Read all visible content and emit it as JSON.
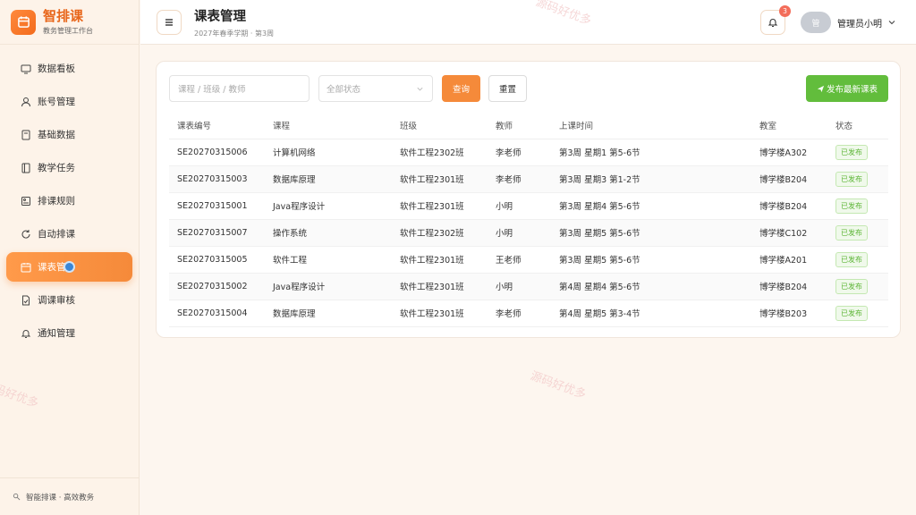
{
  "brand": {
    "title": "智排课",
    "subtitle": "教务管理工作台"
  },
  "sidebar": {
    "items": [
      {
        "label": "数据看板",
        "icon": "dashboard-icon",
        "active": false
      },
      {
        "label": "账号管理",
        "icon": "user-icon",
        "active": false
      },
      {
        "label": "基础数据",
        "icon": "database-icon",
        "active": false
      },
      {
        "label": "教学任务",
        "icon": "book-icon",
        "active": false
      },
      {
        "label": "排课规则",
        "icon": "rules-icon",
        "active": false
      },
      {
        "label": "自动排课",
        "icon": "refresh-icon",
        "active": false
      },
      {
        "label": "课表管",
        "icon": "calendar-icon",
        "active": true
      },
      {
        "label": "调课审核",
        "icon": "document-check-icon",
        "active": false
      },
      {
        "label": "通知管理",
        "icon": "bell-icon",
        "active": false
      }
    ],
    "footer": "智能排课 · 高效教务"
  },
  "header": {
    "title": "课表管理",
    "subtitle": "2027年春季学期 · 第3周",
    "notification_count": "3",
    "avatar_text": "管",
    "user_name": "管理员小明"
  },
  "toolbar": {
    "search_placeholder": "课程 / 班级 / 教师",
    "status_select": "全部状态",
    "query_label": "查询",
    "reset_label": "重置",
    "publish_label": "发布最新课表"
  },
  "table": {
    "columns": [
      "课表编号",
      "课程",
      "班级",
      "教师",
      "上课时间",
      "教室",
      "状态"
    ],
    "rows": [
      [
        "SE20270315006",
        "计算机网络",
        "软件工程2302班",
        "李老师",
        "第3周 星期1 第5-6节",
        "博学楼A302",
        "已发布"
      ],
      [
        "SE20270315003",
        "数据库原理",
        "软件工程2301班",
        "李老师",
        "第3周 星期3 第1-2节",
        "博学楼B204",
        "已发布"
      ],
      [
        "SE20270315001",
        "Java程序设计",
        "软件工程2301班",
        "小明",
        "第3周 星期4 第5-6节",
        "博学楼B204",
        "已发布"
      ],
      [
        "SE20270315007",
        "操作系统",
        "软件工程2302班",
        "小明",
        "第3周 星期5 第5-6节",
        "博学楼C102",
        "已发布"
      ],
      [
        "SE20270315005",
        "软件工程",
        "软件工程2301班",
        "王老师",
        "第3周 星期5 第5-6节",
        "博学楼A201",
        "已发布"
      ],
      [
        "SE20270315002",
        "Java程序设计",
        "软件工程2301班",
        "小明",
        "第4周 星期4 第5-6节",
        "博学楼B204",
        "已发布"
      ],
      [
        "SE20270315004",
        "数据库原理",
        "软件工程2301班",
        "李老师",
        "第4周 星期5 第3-4节",
        "博学楼B203",
        "已发布"
      ]
    ]
  },
  "watermark": "源码好优多",
  "colors": {
    "accent": "#f58a3a",
    "publish": "#62bd3c",
    "status_green": "#5cb536"
  }
}
